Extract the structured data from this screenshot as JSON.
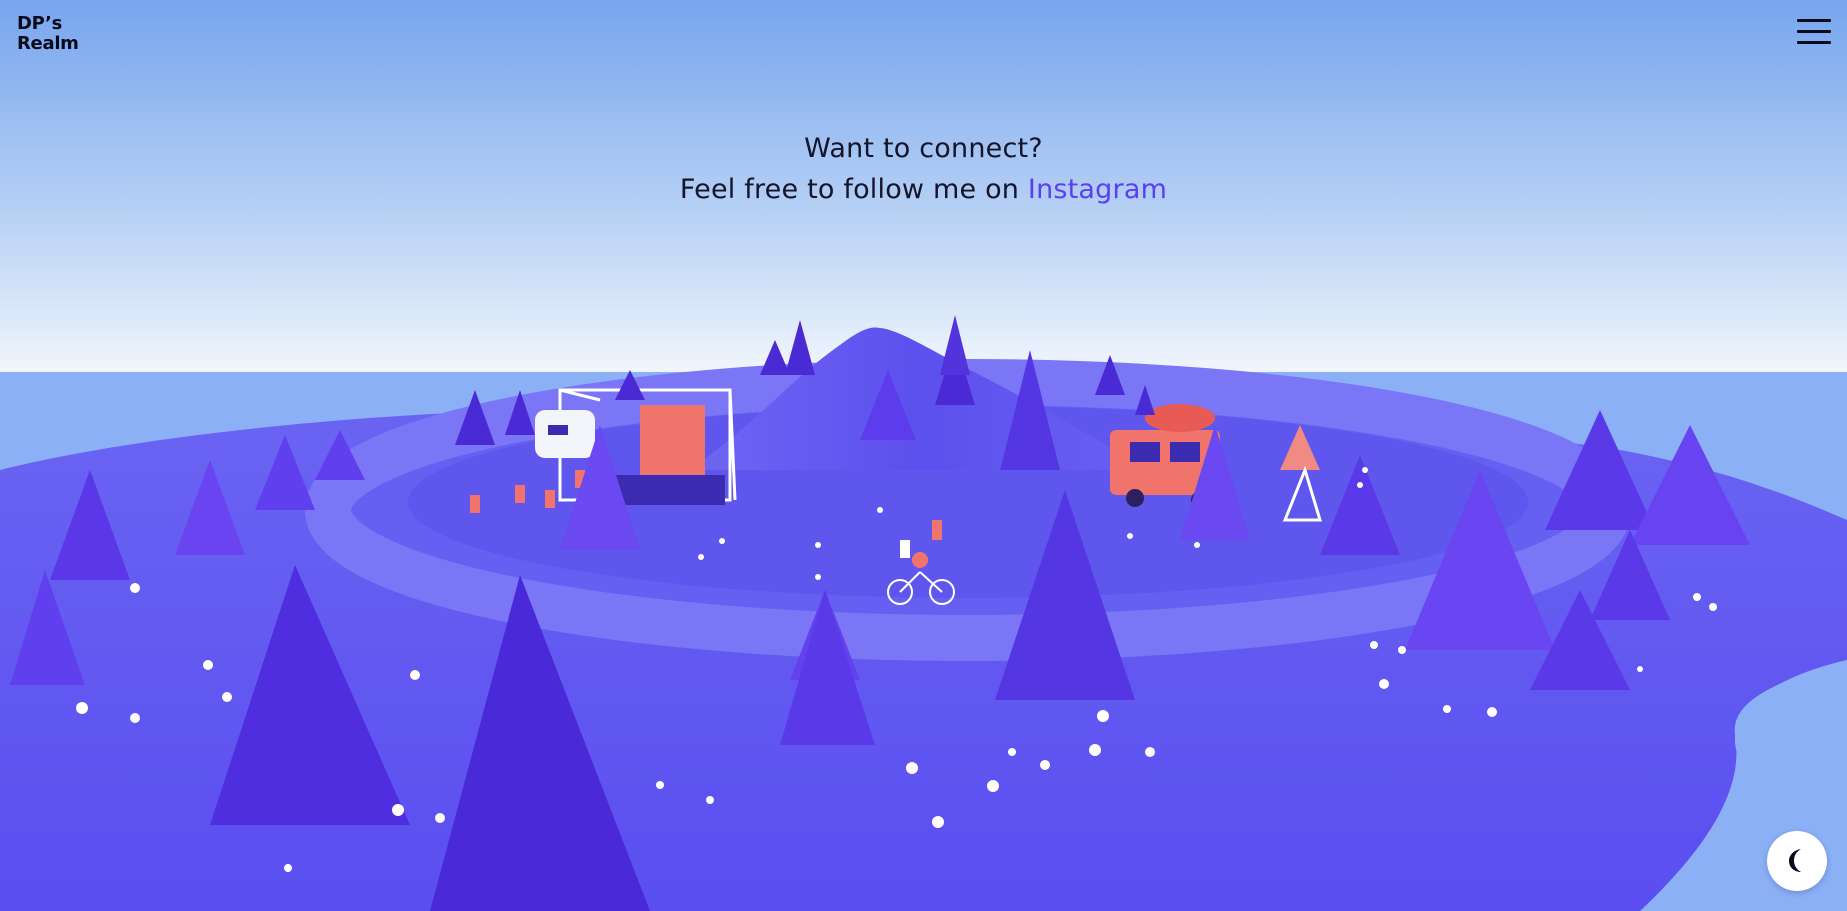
{
  "header": {
    "logo_line1": "DP’s",
    "logo_line2": "Realm",
    "menu_icon": "hamburger-menu-icon"
  },
  "hero": {
    "line1": "Want to connect?",
    "line2_prefix": "Feel free to follow me on ",
    "link_label": "Instagram"
  },
  "theme_toggle": {
    "icon": "moon-icon"
  },
  "colors": {
    "sky_top": "#78a6ee",
    "sky_horizon": "#eef4fc",
    "sea": "#8bb0f6",
    "ground": "#5f55f2",
    "hill": "#6a5ff0",
    "road": "#7b77f5",
    "tree_light": "#6a3ff0",
    "tree_dark": "#3f1bc4",
    "accent": "#5b3ff1",
    "coral": "#f0746c"
  }
}
